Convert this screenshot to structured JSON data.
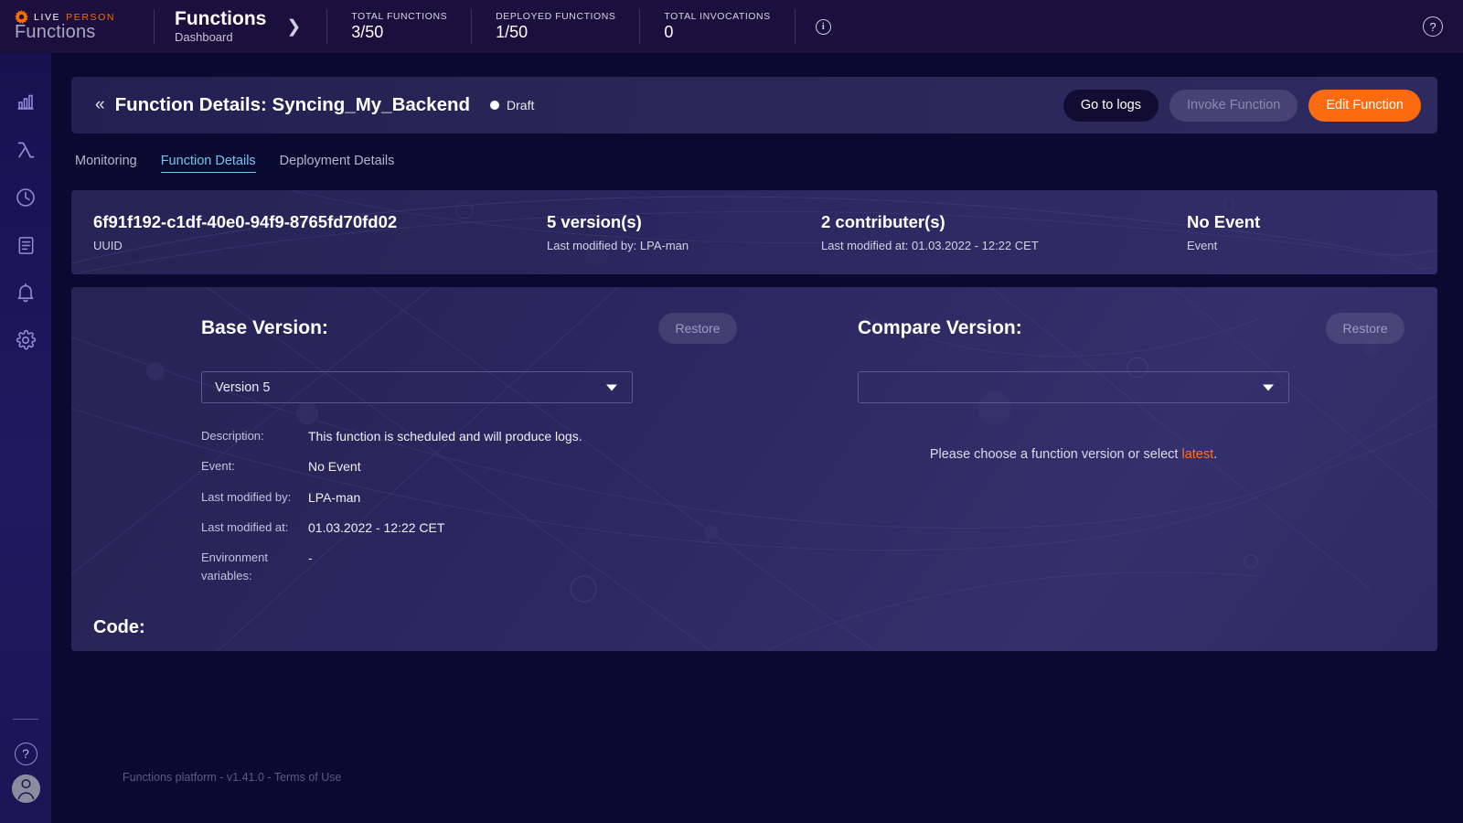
{
  "topbar": {
    "brand": {
      "live": "LIVE",
      "person": "PERSON",
      "product": "Functions",
      "logo_icon": "gear-logo-icon"
    },
    "breadcrumb": {
      "title": "Functions",
      "subtitle": "Dashboard",
      "chevron_icon": "chevron-right-icon"
    },
    "stats": [
      {
        "label": "TOTAL FUNCTIONS",
        "value": "3/50"
      },
      {
        "label": "DEPLOYED FUNCTIONS",
        "value": "1/50"
      },
      {
        "label": "TOTAL INVOCATIONS",
        "value": "0"
      }
    ],
    "info_icon": "info-circle-icon",
    "info_glyph": "i",
    "help_icon": "help-circle-icon",
    "help_glyph": "?"
  },
  "sidebar": {
    "items": [
      {
        "name": "sidebar-item-analytics",
        "icon": "bar-chart-icon"
      },
      {
        "name": "sidebar-item-functions",
        "icon": "lambda-icon"
      },
      {
        "name": "sidebar-item-history",
        "icon": "clock-icon"
      },
      {
        "name": "sidebar-item-logs",
        "icon": "document-icon"
      },
      {
        "name": "sidebar-item-notifications",
        "icon": "bell-icon"
      },
      {
        "name": "sidebar-item-settings",
        "icon": "gear-icon"
      }
    ],
    "help_icon": "help-circle-icon",
    "help_glyph": "?",
    "avatar_icon": "user-avatar-icon"
  },
  "header": {
    "back_icon": "double-chevron-left-icon",
    "back_glyph": "«",
    "title": "Function Details: Syncing_My_Backend",
    "status": "Draft",
    "status_dot_color": "#ffffff",
    "buttons": {
      "logs": "Go to logs",
      "invoke": "Invoke Function",
      "edit": "Edit Function"
    },
    "edit_color": "#fc6b10"
  },
  "tabs": [
    {
      "label": "Monitoring",
      "active": false
    },
    {
      "label": "Function Details",
      "active": true
    },
    {
      "label": "Deployment Details",
      "active": false
    }
  ],
  "info_card": [
    {
      "big": "6f91f192-c1df-40e0-94f9-8765fd70fd02",
      "small": "UUID"
    },
    {
      "big": "5 version(s)",
      "small": "Last modified by: LPA-man"
    },
    {
      "big": "2 contributer(s)",
      "small": "Last modified at: 01.03.2022 - 12:22 CET"
    },
    {
      "big": "No Event",
      "small": "Event"
    }
  ],
  "base_version": {
    "title": "Base Version:",
    "restore_label": "Restore",
    "select_value": "Version 5",
    "caret_icon": "chevron-down-icon",
    "meta": [
      {
        "key": "Description:",
        "value": "This function is scheduled and will produce logs."
      },
      {
        "key": "Event:",
        "value": "No Event"
      },
      {
        "key": "Last modified by:",
        "value": "LPA-man"
      },
      {
        "key": "Last modified at:",
        "value": "01.03.2022 - 12:22 CET"
      },
      {
        "key": "Environment variables:",
        "value": "-"
      }
    ],
    "code_label": "Code:"
  },
  "compare_version": {
    "title": "Compare Version:",
    "restore_label": "Restore",
    "select_value": "",
    "caret_icon": "chevron-down-icon",
    "hint_prefix": "Please choose a function version or select ",
    "hint_link": "latest",
    "hint_suffix": ".",
    "link_color": "#fc7223"
  },
  "footer": {
    "text": "Functions platform - v1.41.0 - Terms of Use"
  }
}
